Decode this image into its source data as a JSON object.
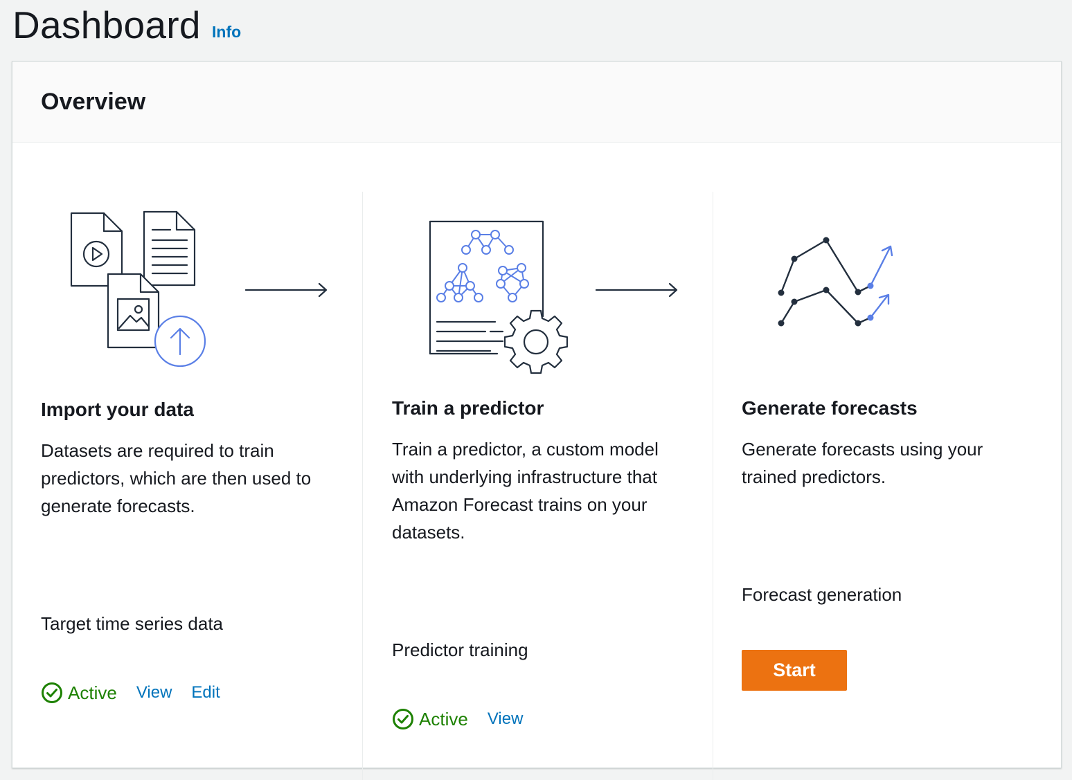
{
  "header": {
    "title": "Dashboard",
    "info_label": "Info"
  },
  "overview": {
    "title": "Overview",
    "steps": [
      {
        "title": "Import your data",
        "description": "Datasets are required to train predictors, which are then used to generate forecasts.",
        "item_label": "Target time series data",
        "status": "Active",
        "actions": [
          "View",
          "Edit"
        ],
        "illustration": "import-data-icon"
      },
      {
        "title": "Train a predictor",
        "description": "Train a predictor, a custom model with underlying infrastructure that Amazon Forecast trains on your datasets.",
        "item_label": "Predictor training",
        "status": "Active",
        "actions": [
          "View"
        ],
        "illustration": "train-predictor-icon"
      },
      {
        "title": "Generate forecasts",
        "description": "Generate forecasts using your trained predictors.",
        "item_label": "Forecast generation",
        "button_label": "Start",
        "illustration": "generate-forecasts-icon"
      }
    ]
  },
  "colors": {
    "link": "#0073bb",
    "success": "#1d8102",
    "primary_button": "#ec7211",
    "accent_illustration": "#5a7fe6",
    "text": "#16191f",
    "background": "#f2f3f3"
  }
}
